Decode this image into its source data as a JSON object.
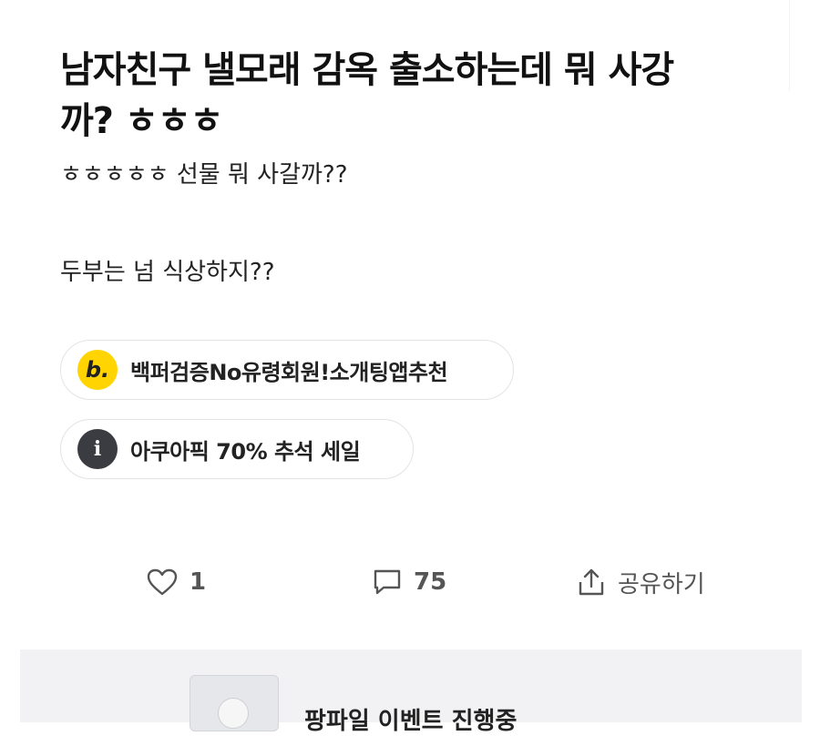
{
  "post": {
    "title": "남자친구 낼모래 감옥 출소하는데 뭐 사강까? ㅎㅎㅎ",
    "body_line1": "ㅎㅎㅎㅎㅎ 선물 뭐 사갈까??",
    "body_line2": "두부는 넘 식상하지??"
  },
  "ads": [
    {
      "icon_letter": "b.",
      "label": "백퍼검증No유령회원!소개팅앱추천"
    },
    {
      "icon_letter": "i",
      "label": "아쿠아픽 70% 추석 세일"
    }
  ],
  "actions": {
    "like_count": "1",
    "comment_count": "75",
    "share_label": "공유하기"
  },
  "banner": {
    "text": "팡파일 이벤트 진행중"
  },
  "colors": {
    "badge_yellow": "#ffd400",
    "badge_dark": "#3a3c42"
  }
}
